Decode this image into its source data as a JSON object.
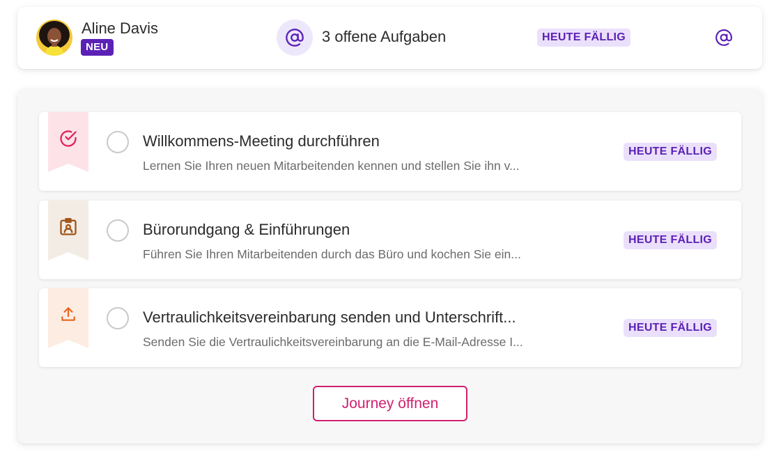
{
  "header": {
    "user_name": "Aline Davis",
    "new_badge": "NEU",
    "open_tasks": "3 offene Aufgaben",
    "due_badge": "HEUTE FÄLLIG",
    "mention_icon": "at-sign-icon"
  },
  "tasks": [
    {
      "icon": "check-circle-icon",
      "ribbon_color": "#fde3e8",
      "icon_color": "#e0245e",
      "title": "Willkommens-Meeting durchführen",
      "description": "Lernen Sie Ihren neuen Mitarbeitenden kennen und stellen Sie ihn v...",
      "due": "HEUTE FÄLLIG"
    },
    {
      "icon": "id-badge-icon",
      "ribbon_color": "#f3ece4",
      "icon_color": "#a0541a",
      "title": "Bürorundgang & Einführungen",
      "description": "Führen Sie Ihren Mitarbeitenden durch das Büro und kochen Sie ein...",
      "due": "HEUTE FÄLLIG"
    },
    {
      "icon": "upload-icon",
      "ribbon_color": "#fdece2",
      "icon_color": "#e8651e",
      "title": "Vertraulichkeitsvereinbarung senden und Unterschrift...",
      "description": "Senden Sie die Vertraulichkeitsvereinbarung an die E-Mail-Adresse I...",
      "due": "HEUTE FÄLLIG"
    }
  ],
  "journey_button": "Journey öffnen",
  "colors": {
    "purple": "#5b21b6",
    "purple_light": "#ebe0fb",
    "magenta": "#d0206f"
  }
}
